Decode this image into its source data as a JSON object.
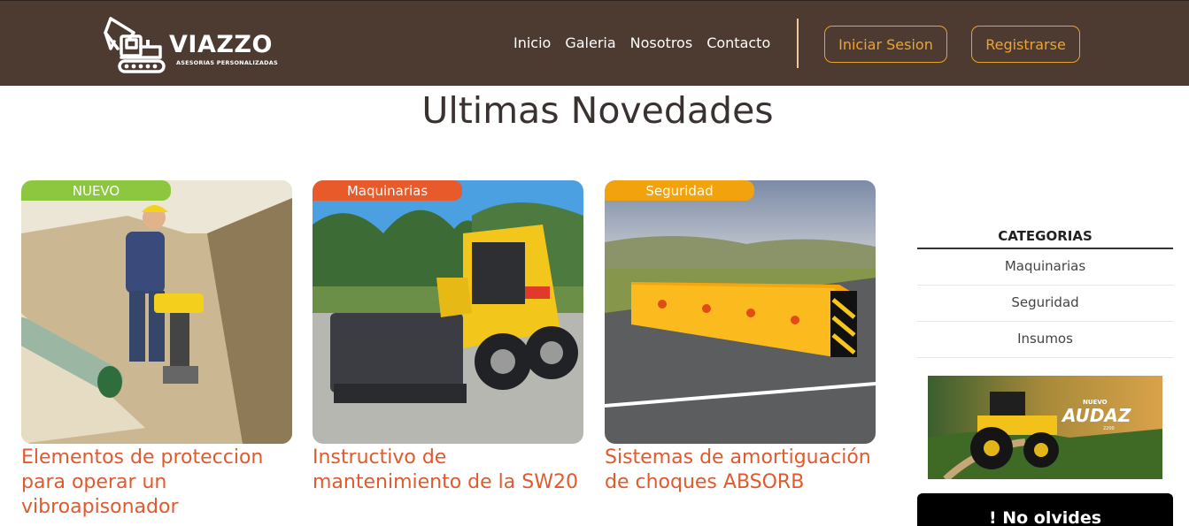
{
  "brand": {
    "name": "VIAZZO",
    "tagline": "ASESORIAS PERSONALIZADAS"
  },
  "nav": {
    "items": [
      {
        "label": "Inicio"
      },
      {
        "label": "Galeria"
      },
      {
        "label": "Nosotros"
      },
      {
        "label": "Contacto"
      }
    ],
    "login_label": "Iniciar Sesion",
    "register_label": "Registrarse"
  },
  "colors": {
    "header_bg": "#4d3a30",
    "accent_orange": "#e05a2e",
    "button_gold": "#f0a32c",
    "badge_green": "#8dc63f",
    "badge_orange": "#e85a2a",
    "badge_yellow": "#f2a20c"
  },
  "main": {
    "title": "Ultimas Novedades",
    "cards": [
      {
        "badge": "NUEVO",
        "title": "Elementos de proteccion para operar un vibroapisonador",
        "image": "vibratory-rammer-photo"
      },
      {
        "badge": "Maquinarias",
        "title": "Instructivo de mantenimiento de la SW20",
        "image": "skid-steer-loader-photo"
      },
      {
        "badge": "Seguridad",
        "title": "Sistemas de amortiguación de choques ABSORB",
        "image": "crash-barrier-photo"
      }
    ]
  },
  "sidebar": {
    "categories_title": "CATEGORIAS",
    "categories": [
      {
        "label": "Maquinarias"
      },
      {
        "label": "Seguridad"
      },
      {
        "label": "Insumos"
      }
    ],
    "promo": {
      "label_top": "NUEVO",
      "label_main": "AUDAZ",
      "label_model": "2200",
      "image": "tractor-ad-photo"
    },
    "reminder_title": "! No olvides"
  }
}
